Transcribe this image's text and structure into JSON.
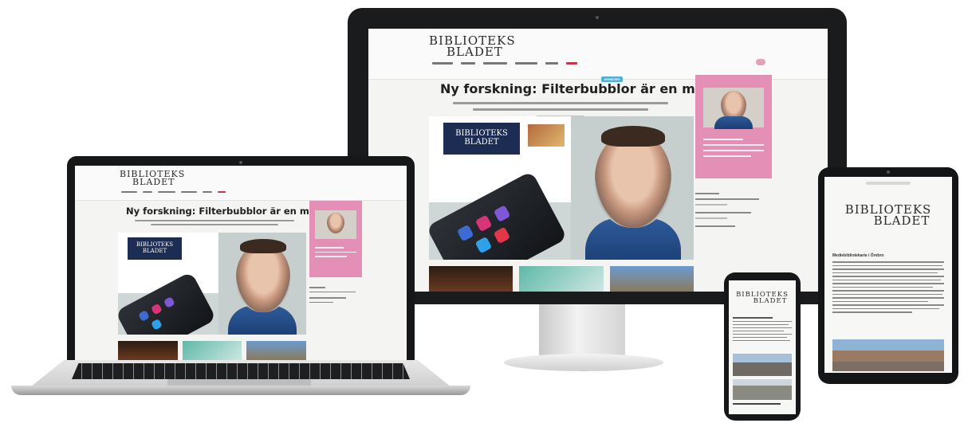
{
  "site": {
    "logo_line1": "BIBLIOTEKS",
    "logo_line2": "BLADET",
    "category_badge": "NYHETER",
    "headline": "Ny forskning: Filterbubblor är en myt",
    "headline_laptop": "Ny forskning: Filterbubblor är en myt",
    "screenshot_logo_line1": "BIBLIOTEKS",
    "screenshot_logo_line2": "BLADET"
  },
  "tablet": {
    "logo_line1": "BIBLIOTEKS",
    "logo_line2": "BLADET",
    "article_heading": "Mediebibliotekarie i Örebro"
  },
  "phone": {
    "logo_line1": "BIBLIOTEKS",
    "logo_line2": "BLADET"
  },
  "colors": {
    "accent_pink": "#e48fb6",
    "badge_blue": "#4ab1d8",
    "nav_red": "#c8344c",
    "bezel": "#1a1b1d"
  },
  "icons": {
    "webcam": "webcam-icon",
    "app_icons": "app-icon"
  }
}
